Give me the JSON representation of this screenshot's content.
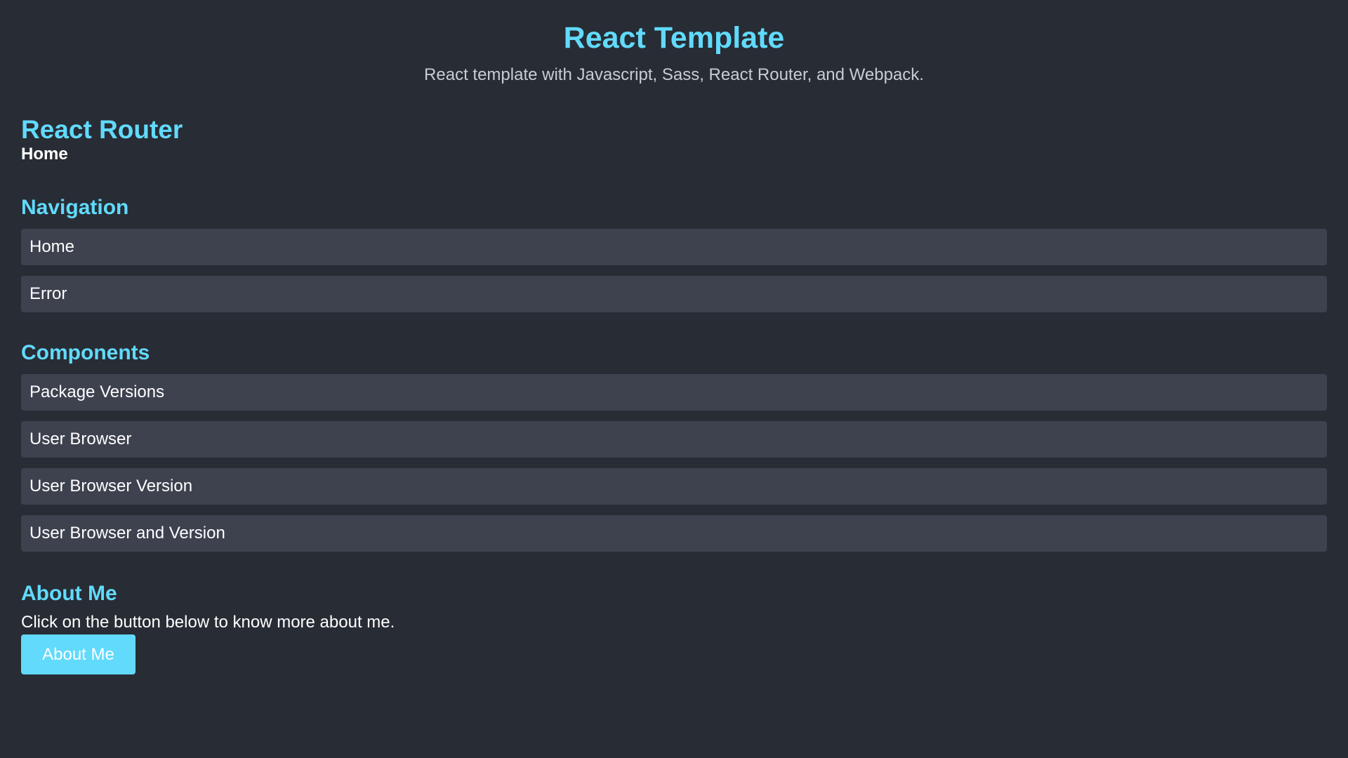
{
  "header": {
    "title": "React Template",
    "subtitle": "React template with Javascript, Sass, React Router, and Webpack."
  },
  "router": {
    "title": "React Router",
    "current_page": "Home"
  },
  "navigation": {
    "title": "Navigation",
    "items": [
      "Home",
      "Error"
    ]
  },
  "components": {
    "title": "Components",
    "items": [
      "Package Versions",
      "User Browser",
      "User Browser Version",
      "User Browser and Version"
    ]
  },
  "about": {
    "title": "About Me",
    "text": "Click on the button below to know more about me.",
    "button_label": "About Me"
  },
  "colors": {
    "background": "#282c34",
    "accent": "#61dafb",
    "item_background": "#3e424f"
  }
}
